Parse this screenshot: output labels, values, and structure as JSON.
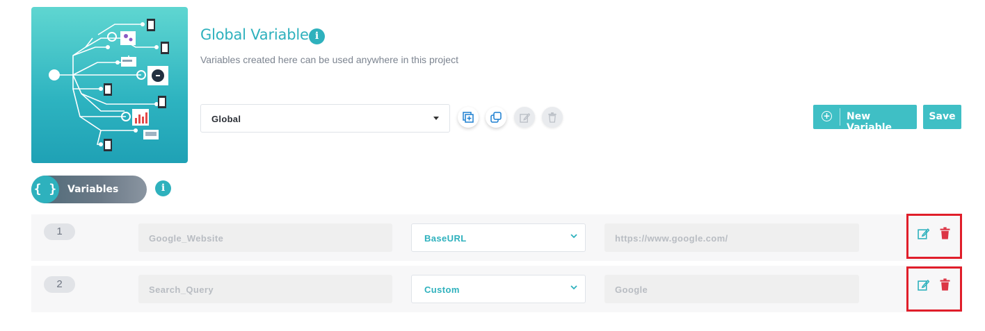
{
  "header": {
    "title": "Global Variable",
    "subtitle": "Variables created here can be used anywhere in this project",
    "info_icon": "info-icon"
  },
  "scope_select": {
    "value": "Global"
  },
  "toolbar": {
    "new_variable_label": "New Variable",
    "save_label": "Save"
  },
  "section": {
    "label": "Variables",
    "badge": "{ }"
  },
  "variables": [
    {
      "index": "1",
      "name": "Google_Website",
      "type": "BaseURL",
      "value": "https://www.google.com/"
    },
    {
      "index": "2",
      "name": "Search_Query",
      "type": "Custom",
      "value": "Google"
    }
  ],
  "colors": {
    "accent": "#2eb1bd",
    "button": "#3fbfc5",
    "delete": "#dc3545",
    "highlight": "#e01e2a"
  }
}
